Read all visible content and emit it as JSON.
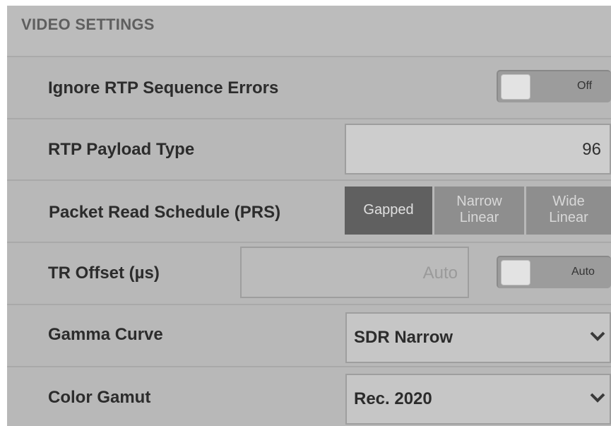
{
  "header": {
    "title": "VIDEO SETTINGS"
  },
  "rows": {
    "ignore_rtp": {
      "label": "Ignore RTP Sequence Errors",
      "toggle_text": "Off",
      "toggle_state": "off"
    },
    "payload_type": {
      "label": "RTP Payload Type",
      "value": "96"
    },
    "prs": {
      "label": "Packet Read Schedule (PRS)",
      "options": [
        {
          "line1": "Gapped",
          "line2": ""
        },
        {
          "line1": "Narrow",
          "line2": "Linear"
        },
        {
          "line1": "Wide",
          "line2": "Linear"
        }
      ],
      "selected": "Gapped"
    },
    "tr_offset": {
      "label": "TR Offset (µs)",
      "value": "Auto",
      "toggle_text": "Auto",
      "toggle_state": "off"
    },
    "gamma": {
      "label": "Gamma Curve",
      "value": "SDR Narrow",
      "icon": "chevron-down-icon"
    },
    "gamut": {
      "label": "Color Gamut",
      "value": "Rec. 2020",
      "icon": "chevron-down-icon"
    }
  },
  "colors": {
    "panel_bg": "#b9b9b9",
    "selected_segment": "#606060",
    "segment": "#8e8e8e"
  }
}
